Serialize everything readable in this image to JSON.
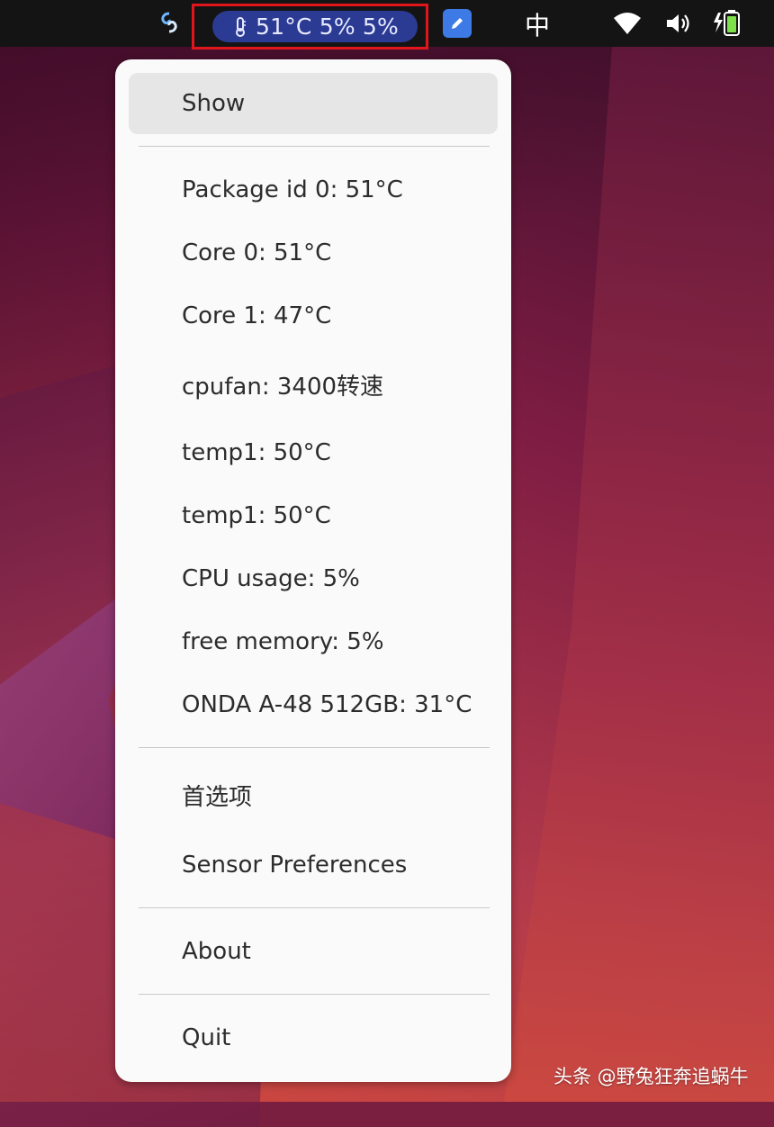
{
  "topbar": {
    "indicator_text": "51°C 5% 5%",
    "ime_label": "中",
    "icons": {
      "app": "swirl-icon",
      "indicator": "thermometer-icon",
      "editor": "text-editor-icon",
      "network": "wifi-icon",
      "sound": "volume-icon",
      "power": "battery-charging-icon"
    }
  },
  "menu": {
    "show": "Show",
    "sensors": [
      "Package id 0: 51°C",
      "Core 0: 51°C",
      "Core 1: 47°C",
      "cpufan: 3400转速",
      "temp1: 50°C",
      "temp1: 50°C",
      "CPU usage: 5%",
      "free memory: 5%",
      "ONDA A-48 512GB: 31°C"
    ],
    "preferences": "首选项",
    "sensor_preferences": "Sensor Preferences",
    "about": "About",
    "quit": "Quit"
  },
  "watermark": "头条 @野兔狂奔追蜗牛",
  "colors": {
    "topbar_bg": "#141414",
    "indicator_bg": "#2b3b93",
    "highlight_border": "#e0161c",
    "menu_bg": "#fafafa"
  }
}
